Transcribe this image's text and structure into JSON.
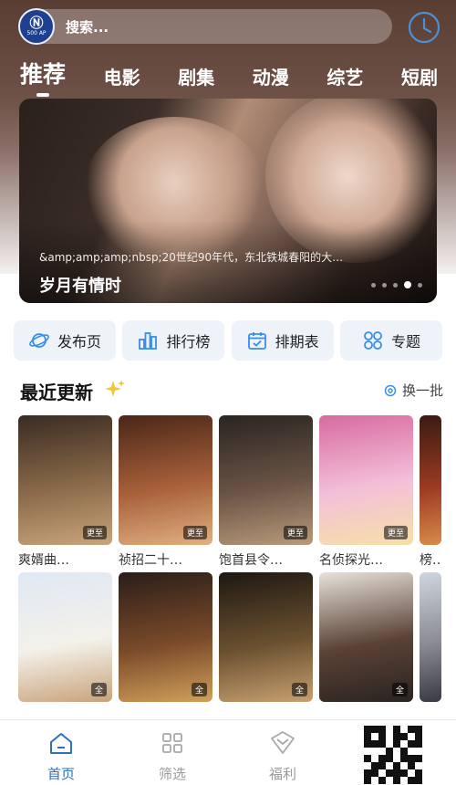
{
  "colors": {
    "accent": "#2f6fc0",
    "icon_blue": "#3a8ee6",
    "quick_bg": "#eef3f9",
    "sparkle": "#f3c53a"
  },
  "header": {
    "logo": {
      "icon": "app-logo",
      "mark": "Ⓝ",
      "sub": "500 AP"
    },
    "search_placeholder": "搜索...",
    "history_icon": "clock-icon"
  },
  "tabs": [
    {
      "label": "推荐",
      "active": true
    },
    {
      "label": "电影",
      "active": false
    },
    {
      "label": "剧集",
      "active": false
    },
    {
      "label": "动漫",
      "active": false
    },
    {
      "label": "综艺",
      "active": false
    },
    {
      "label": "短剧",
      "active": false
    }
  ],
  "banner": {
    "description": "&amp;amp;amp;nbsp;20世纪90年代，东北铁城春阳的大…",
    "title": "岁月有情时",
    "dots": 5,
    "active_dot": 3
  },
  "quick_links": [
    {
      "label": "发布页",
      "icon": "planet-icon"
    },
    {
      "label": "排行榜",
      "icon": "ranking-icon"
    },
    {
      "label": "排期表",
      "icon": "calendar-icon"
    },
    {
      "label": "专题",
      "icon": "grid-icon"
    }
  ],
  "section": {
    "title": "最近更新",
    "refresh_label": "换一批"
  },
  "posters_row1": [
    {
      "title": "爽婿曲…",
      "badge": "更至",
      "colors": [
        "#3a2b22",
        "#8a6a4a",
        "#c9a57a"
      ]
    },
    {
      "title": "祯招二十…",
      "badge": "更至",
      "colors": [
        "#4a2618",
        "#a8603a",
        "#e0b080"
      ]
    },
    {
      "title": "饱首县令…",
      "badge": "更至",
      "colors": [
        "#2a2420",
        "#6a5446",
        "#b99a7a"
      ]
    },
    {
      "title": "名侦探光…",
      "badge": "更至",
      "colors": [
        "#d86aa0",
        "#f3c0d8",
        "#f6e0a8"
      ]
    },
    {
      "title": "榜…",
      "badge": "",
      "colors": [
        "#3a1a12",
        "#9a3a22",
        "#d88a4a"
      ]
    }
  ],
  "posters_row2": [
    {
      "title": "…",
      "badge": "全",
      "colors": [
        "#dfe8f4",
        "#f4f1ea",
        "#c8a27a"
      ]
    },
    {
      "title": "…",
      "badge": "全",
      "colors": [
        "#2a1e18",
        "#7a4a2a",
        "#d0a05a"
      ]
    },
    {
      "title": "…",
      "badge": "全",
      "colors": [
        "#1e1812",
        "#6a5030",
        "#c8a070"
      ]
    },
    {
      "title": "…",
      "badge": "全",
      "colors": [
        "#e8e2da",
        "#5a4236",
        "#2a2420"
      ]
    },
    {
      "title": "…",
      "badge": "",
      "colors": [
        "#cfd6e0",
        "#8a8a92",
        "#3a3a42"
      ]
    }
  ],
  "bottom_nav": [
    {
      "label": "首页",
      "icon": "home-icon",
      "active": true
    },
    {
      "label": "筛选",
      "icon": "filter-icon",
      "active": false
    },
    {
      "label": "福利",
      "icon": "gift-icon",
      "active": false
    }
  ]
}
